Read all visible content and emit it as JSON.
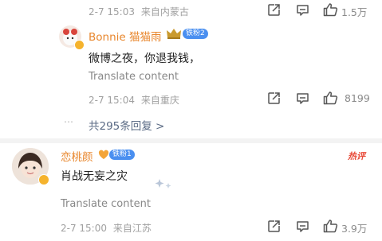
{
  "comment_top": {
    "time": "2-7 15:03",
    "location": "来自内蒙古",
    "likes": "1.5万"
  },
  "reply_bonnie": {
    "username": "Bonnie 猫猫雨",
    "badge": "铁粉2",
    "text": "微博之夜，你退我钱，",
    "translate": "Translate content",
    "time": "2-7 15:04",
    "location": "来自重庆",
    "likes": "8199"
  },
  "replies_link": {
    "dots": "⋯",
    "label": "共295条回复 >"
  },
  "comment_taoyan": {
    "username": "恋桃颜",
    "badge": "铁粉1",
    "hot_tag": "热评",
    "text": "肖战无妄之灾",
    "translate": "Translate content",
    "time": "2-7 15:00",
    "location": "来自江苏",
    "likes": "3.9万"
  },
  "colors": {
    "accent_orange": "#e8862c",
    "badge_blue": "#4a8ff0",
    "hot_red": "#e84a38"
  }
}
